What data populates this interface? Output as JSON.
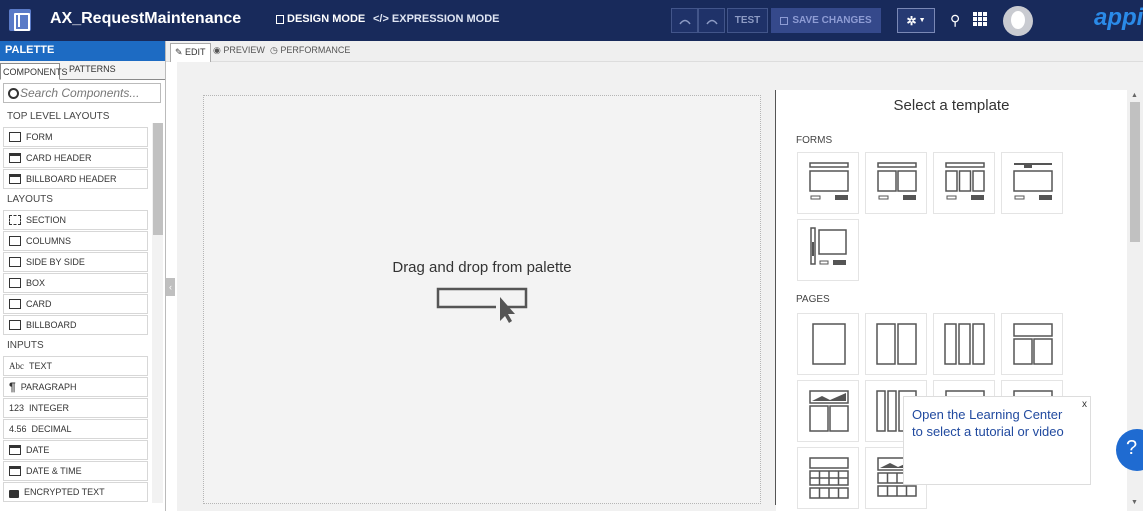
{
  "header": {
    "title": "AX_RequestMaintenance",
    "design_mode": "DESIGN MODE",
    "expression_mode": "EXPRESSION MODE",
    "test": "TEST",
    "save_changes": "SAVE CHANGES",
    "brand": "appia",
    "design_mode_icon": "designer-icon",
    "expression_mode_icon": "code-icon"
  },
  "palette": {
    "title": "PALETTE",
    "tabs": [
      "COMPONENTS",
      "PATTERNS"
    ],
    "search_placeholder": "Search Components...",
    "sections": [
      {
        "label": "TOP LEVEL LAYOUTS",
        "items": [
          {
            "label": "FORM",
            "icon": "form-icon"
          },
          {
            "label": "CARD HEADER",
            "icon": "card-header-icon"
          },
          {
            "label": "BILLBOARD HEADER",
            "icon": "billboard-header-icon"
          }
        ]
      },
      {
        "label": "LAYOUTS",
        "items": [
          {
            "label": "SECTION",
            "icon": "section-icon"
          },
          {
            "label": "COLUMNS",
            "icon": "columns-icon"
          },
          {
            "label": "SIDE BY SIDE",
            "icon": "side-by-side-icon"
          },
          {
            "label": "BOX",
            "icon": "box-icon"
          },
          {
            "label": "CARD",
            "icon": "card-icon"
          },
          {
            "label": "BILLBOARD",
            "icon": "billboard-icon"
          }
        ]
      },
      {
        "label": "INPUTS",
        "items": [
          {
            "label": "TEXT",
            "icon": "text-icon",
            "glyph": "Abc"
          },
          {
            "label": "PARAGRAPH",
            "icon": "paragraph-icon",
            "glyph": "¶"
          },
          {
            "label": "INTEGER",
            "icon": "integer-icon",
            "glyph": "123"
          },
          {
            "label": "DECIMAL",
            "icon": "decimal-icon",
            "glyph": "4.56"
          },
          {
            "label": "DATE",
            "icon": "calendar-icon"
          },
          {
            "label": "DATE & TIME",
            "icon": "date-time-icon"
          },
          {
            "label": "ENCRYPTED TEXT",
            "icon": "lock-icon"
          }
        ]
      }
    ]
  },
  "editor_tabs": [
    "EDIT",
    "PREVIEW",
    "PERFORMANCE"
  ],
  "canvas": {
    "drop_text": "Drag and drop from palette"
  },
  "templates": {
    "title": "Select a template",
    "forms_label": "FORMS",
    "pages_label": "PAGES"
  },
  "tooltip": {
    "line1": "Open the Learning Center",
    "line2": "to select a tutorial or video",
    "close": "x"
  },
  "help": "?"
}
